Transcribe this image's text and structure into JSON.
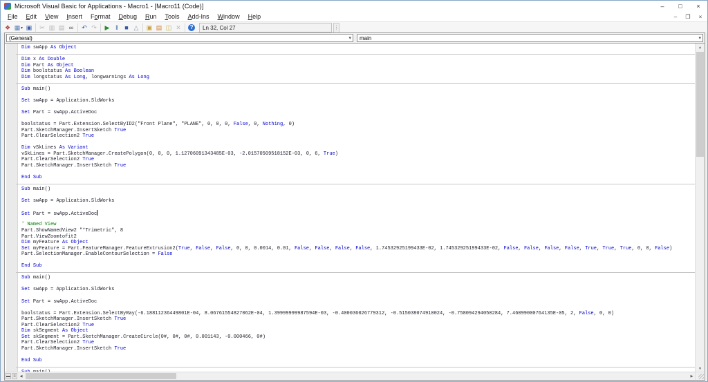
{
  "window": {
    "title": "Microsoft Visual Basic for Applications - Macro1 - [Macro11 (Code)]",
    "controls": {
      "minimize": "–",
      "maximize": "□",
      "close": "×"
    },
    "mdi_controls": {
      "minimize": "–",
      "restore": "❐",
      "close": "×"
    }
  },
  "menu": {
    "items": [
      {
        "label": "File",
        "u": 0
      },
      {
        "label": "Edit",
        "u": 0
      },
      {
        "label": "View",
        "u": 0
      },
      {
        "label": "Insert",
        "u": 0
      },
      {
        "label": "Format",
        "u": 1
      },
      {
        "label": "Debug",
        "u": 0
      },
      {
        "label": "Run",
        "u": 0
      },
      {
        "label": "Tools",
        "u": 0
      },
      {
        "label": "Add-Ins",
        "u": 0
      },
      {
        "label": "Window",
        "u": 0
      },
      {
        "label": "Help",
        "u": 0
      }
    ]
  },
  "toolbar": {
    "position_label": "Ln 32, Col 27",
    "icons": [
      {
        "name": "view-solidworks-icon",
        "glyph": "❖",
        "color": "#b03535",
        "dropdown": false,
        "group_start": false
      },
      {
        "name": "insert-userform-icon",
        "glyph": "▦",
        "color": "#5c7fb5",
        "dropdown": true,
        "group_start": false
      },
      {
        "name": "save-icon",
        "glyph": "▣",
        "color": "#3a5fa8",
        "dropdown": false,
        "group_start": false
      },
      {
        "name": "cut-icon",
        "glyph": "✂",
        "color": "#b5b5b5",
        "dropdown": false,
        "group_start": true
      },
      {
        "name": "copy-icon",
        "glyph": "▥",
        "color": "#b5b5b5",
        "dropdown": false,
        "group_start": false
      },
      {
        "name": "paste-icon",
        "glyph": "▤",
        "color": "#b5b5b5",
        "dropdown": false,
        "group_start": false
      },
      {
        "name": "find-icon",
        "glyph": "∞",
        "color": "#555555",
        "dropdown": false,
        "group_start": false
      },
      {
        "name": "undo-icon",
        "glyph": "↶",
        "color": "#2b5cc4",
        "dropdown": false,
        "group_start": true
      },
      {
        "name": "redo-icon",
        "glyph": "↷",
        "color": "#b5b5b5",
        "dropdown": false,
        "group_start": false
      },
      {
        "name": "run-icon",
        "glyph": "▶",
        "color": "#2d8a2d",
        "dropdown": false,
        "group_start": true
      },
      {
        "name": "break-icon",
        "glyph": "‖",
        "color": "#4466aa",
        "dropdown": false,
        "group_start": false
      },
      {
        "name": "reset-icon",
        "glyph": "■",
        "color": "#35589e",
        "dropdown": false,
        "group_start": false
      },
      {
        "name": "design-mode-icon",
        "glyph": "△",
        "color": "#8a97ab",
        "dropdown": false,
        "group_start": false
      },
      {
        "name": "project-explorer-icon",
        "glyph": "▣",
        "color": "#c9a23a",
        "dropdown": false,
        "group_start": true
      },
      {
        "name": "properties-window-icon",
        "glyph": "▤",
        "color": "#d2813a",
        "dropdown": false,
        "group_start": false
      },
      {
        "name": "object-browser-icon",
        "glyph": "◫",
        "color": "#bfae3e",
        "dropdown": false,
        "group_start": false
      },
      {
        "name": "toolbox-icon",
        "glyph": "✕",
        "color": "#bbbbbb",
        "dropdown": false,
        "group_start": false
      },
      {
        "name": "help-icon",
        "glyph": "?",
        "color": "#ffffff",
        "dropdown": false,
        "group_start": true
      }
    ]
  },
  "combos": {
    "object_dropdown": "(General)",
    "procedure_dropdown": "main",
    "arrow": "▾"
  },
  "code": {
    "caret_row": 28,
    "keywords": [
      "Dim",
      "As",
      "Set",
      "Sub",
      "End",
      "True",
      "False",
      "Nothing",
      "Object",
      "Double",
      "Boolean",
      "Long",
      "Variant"
    ],
    "lines": [
      {
        "text": "Dim swApp As Object"
      },
      {
        "separator": true
      },
      {
        "text": "Dim x As Double"
      },
      {
        "text": "Dim Part As Object"
      },
      {
        "text": "Dim boolstatus As Boolean"
      },
      {
        "text": "Dim longstatus As Long, longwarnings As Long"
      },
      {
        "separator": true
      },
      {
        "text": "Sub main()"
      },
      {
        "text": ""
      },
      {
        "text": "Set swApp = Application.SldWorks"
      },
      {
        "text": ""
      },
      {
        "text": "Set Part = swApp.ActiveDoc"
      },
      {
        "text": ""
      },
      {
        "text": "boolstatus = Part.Extension.SelectByID2(\"Front Plane\", \"PLANE\", 0, 0, 0, False, 0, Nothing, 0)"
      },
      {
        "text": "Part.SketchManager.InsertSketch True"
      },
      {
        "text": "Part.ClearSelection2 True"
      },
      {
        "text": ""
      },
      {
        "text": "Dim vSkLines As Variant"
      },
      {
        "text": "vSkLines = Part.SketchManager.CreatePolygon(0, 0, 0, 1.12706091343485E-03, -2.01570509518152E-03, 0, 6, True)"
      },
      {
        "text": "Part.ClearSelection2 True"
      },
      {
        "text": "Part.SketchManager.InsertSketch True"
      },
      {
        "text": ""
      },
      {
        "text": "End Sub"
      },
      {
        "separator": true
      },
      {
        "text": "Sub main()"
      },
      {
        "text": ""
      },
      {
        "text": "Set swApp = Application.SldWorks"
      },
      {
        "text": ""
      },
      {
        "text": "Set Part = swApp.ActiveDoc"
      },
      {
        "text": ""
      },
      {
        "text": "' Named View"
      },
      {
        "text": "Part.ShowNamedView2 \"*Trimetric\", 8"
      },
      {
        "text": "Part.ViewZoomtofit2"
      },
      {
        "text": "Dim myFeature As Object"
      },
      {
        "text": "Set myFeature = Part.FeatureManager.FeatureExtrusion2(True, False, False, 0, 0, 0.0014, 0.01, False, False, False, False, 1.74532925199433E-02, 1.74532925199433E-02, False, False, False, False, True, True, True, 0, 0, False)"
      },
      {
        "text": "Part.SelectionManager.EnableContourSelection = False"
      },
      {
        "text": ""
      },
      {
        "text": "End Sub"
      },
      {
        "separator": true
      },
      {
        "text": "Sub main()"
      },
      {
        "text": ""
      },
      {
        "text": "Set swApp = Application.SldWorks"
      },
      {
        "text": ""
      },
      {
        "text": "Set Part = swApp.ActiveDoc"
      },
      {
        "text": ""
      },
      {
        "text": "boolstatus = Part.Extension.SelectByRay(-6.18811236449801E-04, 8.06761554827062E-04, 1.39999999987594E-03, -0.400036026779312, -0.515038074910024, -0.758094294050284, 7.46099000764135E-05, 2, False, 0, 0)"
      },
      {
        "text": "Part.SketchManager.InsertSketch True"
      },
      {
        "text": "Part.ClearSelection2 True"
      },
      {
        "text": "Dim skSegment As Object"
      },
      {
        "text": "Set skSegment = Part.SketchManager.CreateCircle(0#, 0#, 0#, 0.001143, -0.000466, 0#)"
      },
      {
        "text": "Part.ClearSelection2 True"
      },
      {
        "text": "Part.SketchManager.InsertSketch True"
      },
      {
        "text": ""
      },
      {
        "text": "End Sub"
      },
      {
        "separator": true
      },
      {
        "text": "Sub main()"
      }
    ]
  },
  "colors": {
    "keyword": "#0000cc",
    "comment": "#008000",
    "code_text": "#1c1c28",
    "run_green": "#2d8a2d",
    "window_bg": "#ffffff",
    "chrome_bg": "#f0f0f0"
  }
}
